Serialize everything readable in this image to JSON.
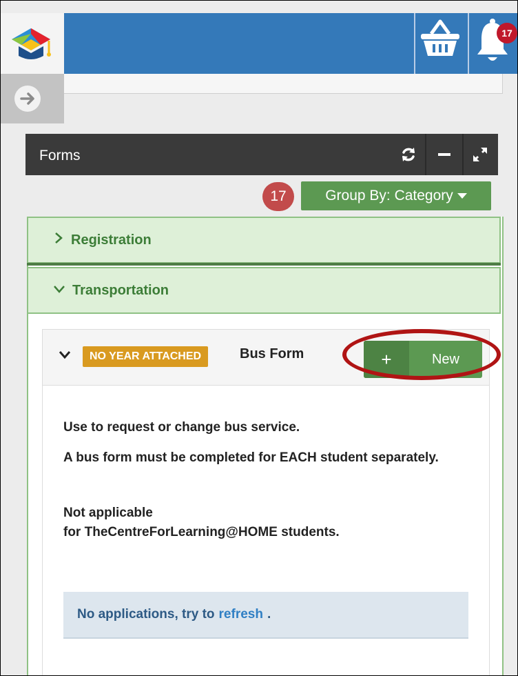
{
  "header": {
    "bell_count": "17"
  },
  "forms_widget": {
    "title": "Forms",
    "count": "17",
    "group_by_label": "Group By: Category"
  },
  "categories": [
    {
      "label": "Registration",
      "expanded": false
    },
    {
      "label": "Transportation",
      "expanded": true
    }
  ],
  "form_card": {
    "year_label": "NO YEAR ATTACHED",
    "title": "Bus Form",
    "new_plus": "+",
    "new_label": "New",
    "description": [
      "Use to request or change bus service.",
      "A bus form must be completed for EACH student separately.",
      "Not applicable",
      "for TheCentreForLearning@HOME students."
    ],
    "no_apps_text": "No applications, try to",
    "refresh_link": "refresh",
    "period": "."
  },
  "colors": {
    "topbar": "#3479b9",
    "accent_green": "#5c9952",
    "badge_red": "#c0182b",
    "label_orange": "#d99a20",
    "highlight_ring": "#b01414"
  }
}
